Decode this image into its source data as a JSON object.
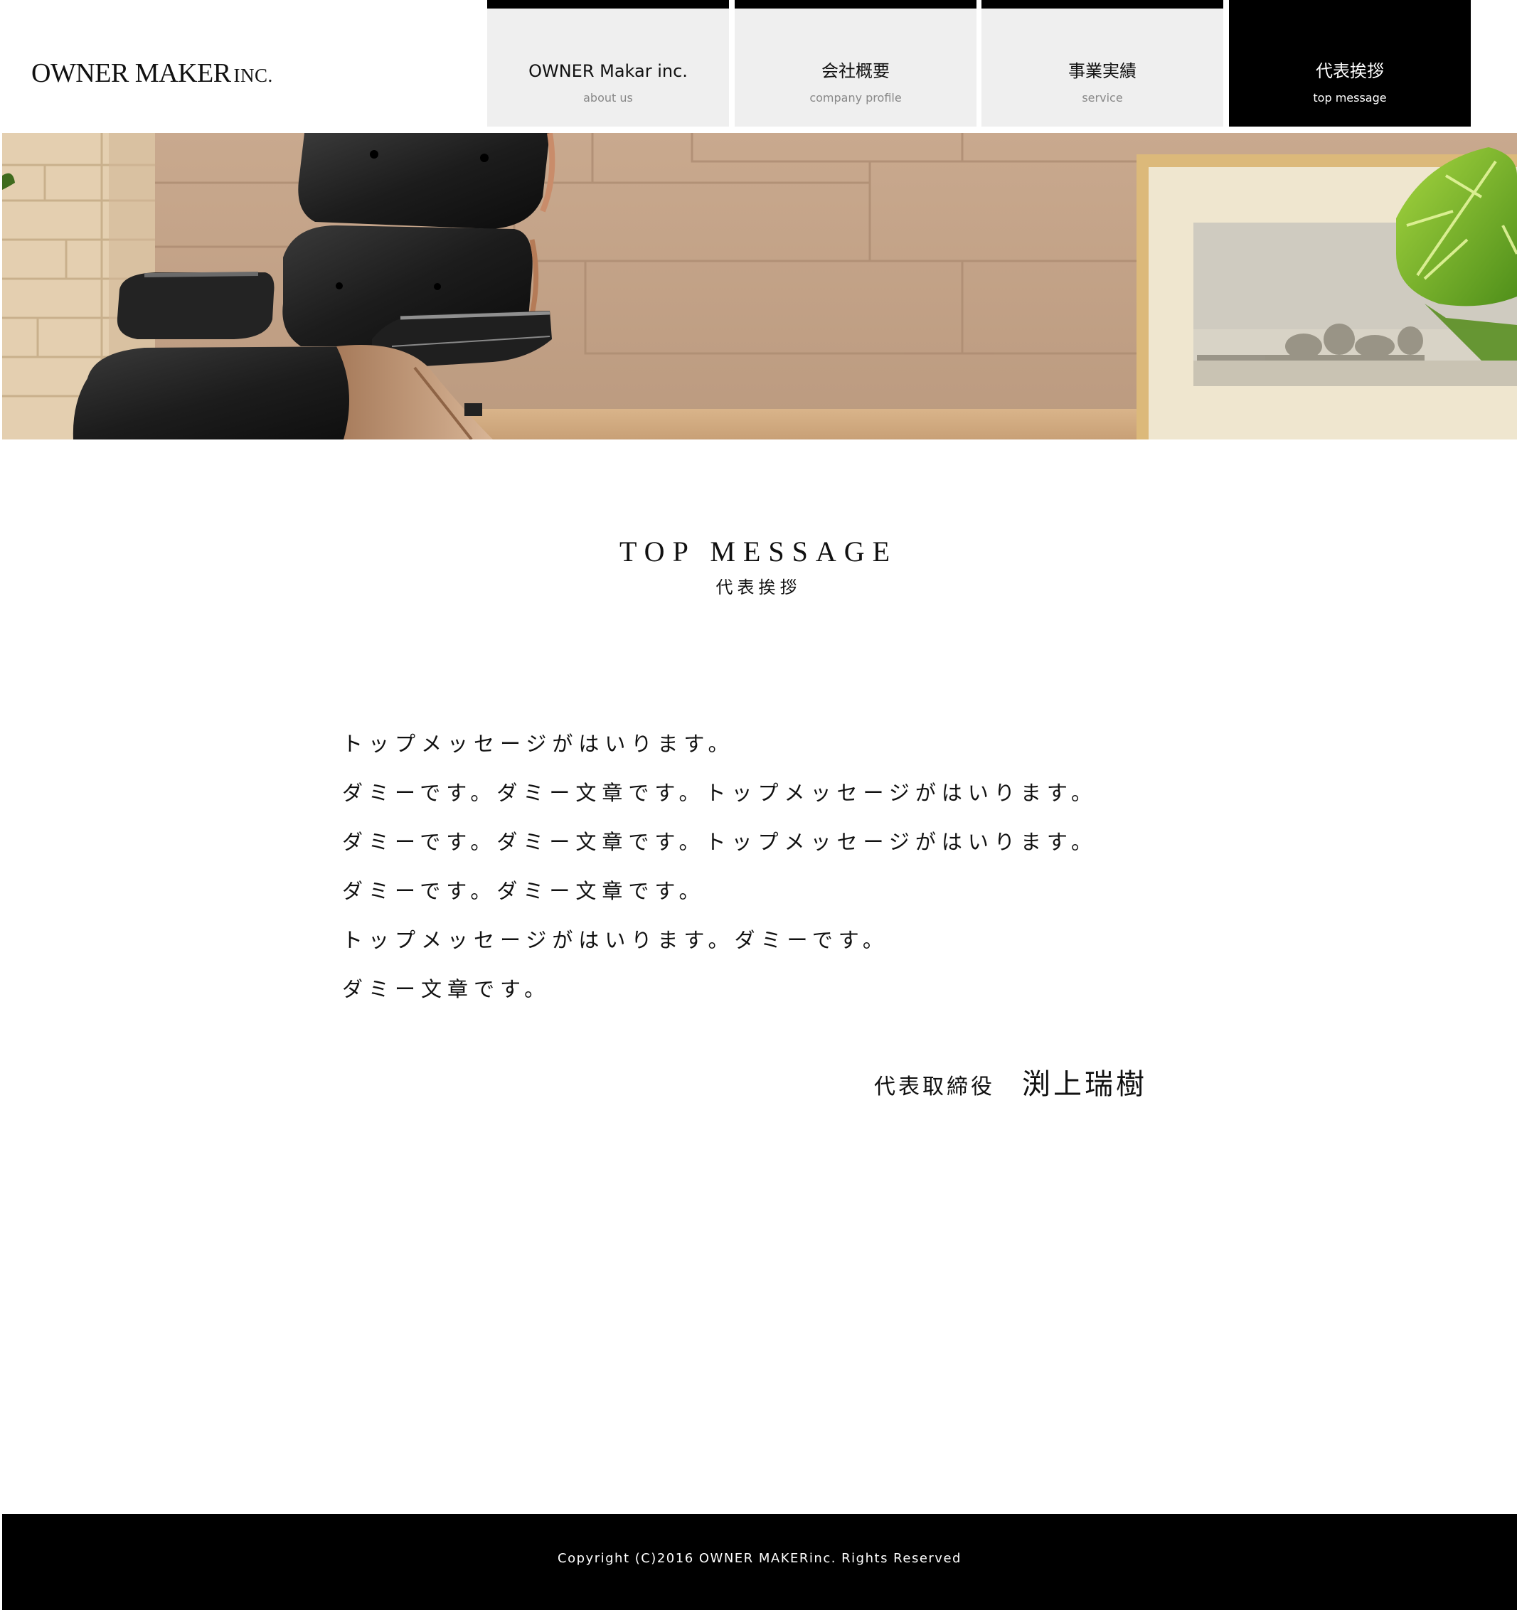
{
  "header": {
    "logo_main": "OWNER MAKER",
    "logo_suffix": "INC."
  },
  "nav": {
    "items": [
      {
        "label": "OWNER Makar inc.",
        "sub": "about us",
        "active": false
      },
      {
        "label": "会社概要",
        "sub": "company profile",
        "active": false
      },
      {
        "label": "事業実績",
        "sub": "service",
        "active": false
      },
      {
        "label": "代表挨拶",
        "sub": "top message",
        "active": true
      }
    ]
  },
  "section": {
    "title": "TOP MESSAGE",
    "subtitle": "代表挨拶"
  },
  "message": {
    "lines": [
      "トップメッセージがはいります。",
      "ダミーです。ダミー文章です。トップメッセージがはいります。",
      "ダミーです。ダミー文章です。トップメッセージがはいります。",
      "ダミーです。ダミー文章です。",
      "トップメッセージがはいります。ダミーです。",
      "ダミー文章です。"
    ]
  },
  "signature": {
    "title": "代表取締役",
    "name": "渕上瑞樹"
  },
  "footer": {
    "copyright": "Copyright (C)2016 OWNER MAKERinc. Rights Reserved"
  },
  "colors": {
    "nav_bg": "#efefef",
    "nav_active_bg": "#000000",
    "footer_bg": "#000000",
    "text": "#111111"
  }
}
